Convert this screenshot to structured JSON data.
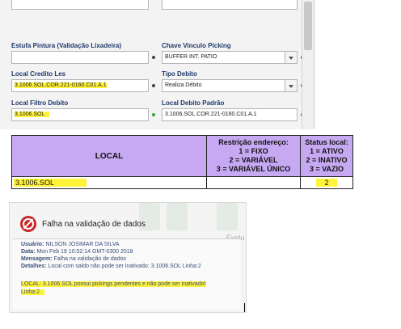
{
  "form": {
    "fields": [
      {
        "label": "Estufa Pintura (Validação Lixadeira)",
        "value": ""
      },
      {
        "label": "Chave Vinculo Picking",
        "value": "BUFFER INT. PATIO"
      },
      {
        "label": "Local Credito Les",
        "value": "3.1006.SOL.COR.221-0160.C01.A.1"
      },
      {
        "label": "Tipo Debito",
        "value": "Realiza Débito"
      },
      {
        "label": "Local Filtro Debito",
        "value": "3.1006.SOL"
      },
      {
        "label": "Local Debito Padrão",
        "value": "3.1006.SOL.COR.221-0160.C01.A.1"
      }
    ]
  },
  "table": {
    "headers": {
      "local": "LOCAL",
      "restricao": [
        "Restrição endereço:",
        "1 = FIXO",
        "2 = VARIÁVEL",
        "3 = VARIÁVEL ÚNICO"
      ],
      "status": [
        "Status local:",
        "1 = ATIVO",
        "2 = INATIVO",
        "3 = VAZIO"
      ]
    },
    "row": {
      "local": "3.1006.SOL",
      "restricao": "",
      "status": "2"
    },
    "header_color": "#c7a9f3",
    "highlight_color": "#fff33a"
  },
  "dialog": {
    "title": "Falha na validação de dados",
    "usuario_label": "Usuário:",
    "usuario": "NILSON JOSIMAR DA SILVA",
    "data_label": "Data:",
    "data": "Mon Feb 19 10:52:14 GMT-0300 2018",
    "mensagem_label": "Mensagem:",
    "mensagem": "Falha na validação de dados",
    "detalhes_label": "Detalhes:",
    "detalhes": "Local com saldo não pode ser inativado: 3.1006.SOL Linha:2",
    "detail_line1": "LOCAL: 3.1006.SOL possui pickings pendentes e não pode ser inativado!",
    "detail_line2": "Linha:2",
    "bg_text": "Evolu"
  }
}
